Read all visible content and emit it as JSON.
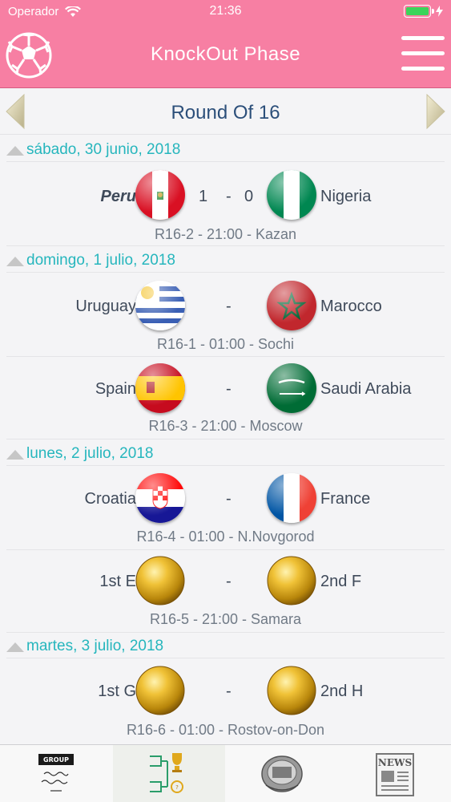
{
  "status_bar": {
    "carrier": "Operador",
    "time": "21:36"
  },
  "header": {
    "title": "KnockOut Phase"
  },
  "round": {
    "title": "Round Of 16"
  },
  "days": [
    {
      "label": "sábado, 30 junio, 2018"
    },
    {
      "label": "domingo, 1 julio, 2018"
    },
    {
      "label": "lunes, 2 julio, 2018"
    },
    {
      "label": "martes, 3 julio, 2018"
    }
  ],
  "matches": [
    {
      "home": "Peru",
      "away": "Nigeria",
      "home_score": "1",
      "separator": "-",
      "away_score": "0",
      "info": "R16-2 - 21:00 - Kazan",
      "home_flag": "peru-flag-icon",
      "away_flag": "nigeria-flag-icon"
    },
    {
      "home": "Uruguay",
      "away": "Marocco",
      "separator": "-",
      "info": "R16-1 - 01:00 - Sochi",
      "home_flag": "uruguay-flag-icon",
      "away_flag": "morocco-flag-icon"
    },
    {
      "home": "Spain",
      "away": "Saudi Arabia",
      "separator": "-",
      "info": "R16-3 - 21:00 - Moscow",
      "home_flag": "spain-flag-icon",
      "away_flag": "saudi-arabia-flag-icon"
    },
    {
      "home": "Croatia",
      "away": "France",
      "separator": "-",
      "info": "R16-4 - 01:00 - N.Novgorod",
      "home_flag": "croatia-flag-icon",
      "away_flag": "france-flag-icon"
    },
    {
      "home": "1st E",
      "away": "2nd F",
      "separator": "-",
      "info": "R16-5 - 21:00 - Samara",
      "home_flag": "gold-globe-icon",
      "away_flag": "gold-globe-icon"
    },
    {
      "home": "1st G",
      "away": "2nd H",
      "separator": "-",
      "info": "R16-6 - 01:00 - Rostov-on-Don",
      "home_flag": "gold-globe-icon",
      "away_flag": "gold-globe-icon"
    }
  ],
  "tabs": [
    {
      "id": "group-stage",
      "icon": "group-board-icon",
      "label": "GROUP"
    },
    {
      "id": "knockout",
      "icon": "bracket-trophy-icon",
      "active": true
    },
    {
      "id": "stadiums",
      "icon": "stadium-icon"
    },
    {
      "id": "news",
      "icon": "newspaper-icon",
      "label": "NEWS"
    }
  ],
  "colors": {
    "header": "#f77fa3",
    "day_text": "#26b6bd",
    "round_title": "#2c4f7a"
  }
}
